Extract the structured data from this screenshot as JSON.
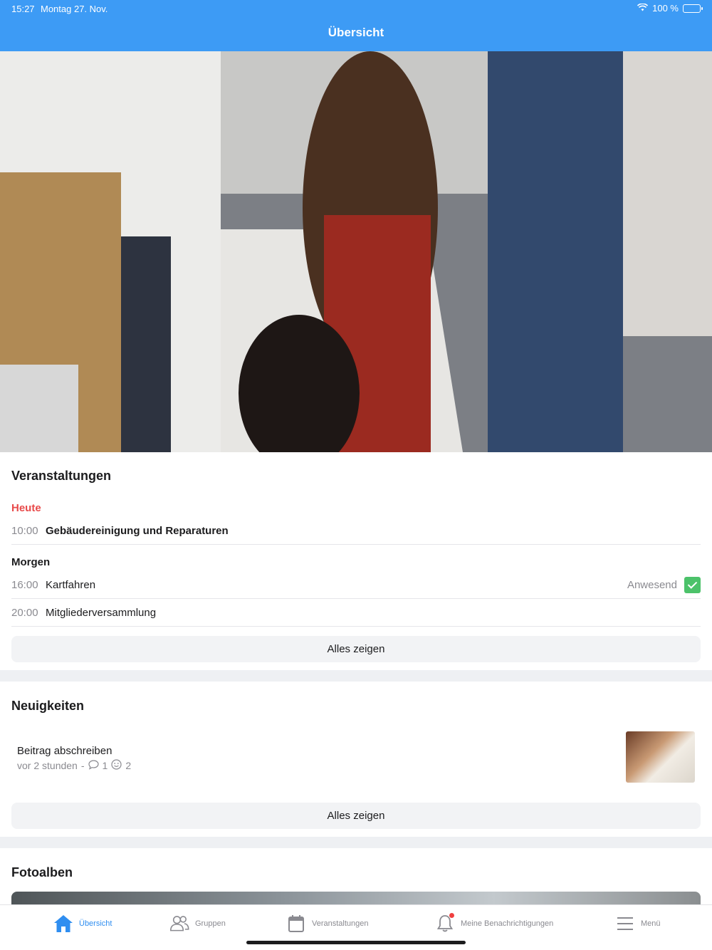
{
  "status_bar": {
    "time": "15:27",
    "date": "Montag 27. Nov.",
    "battery": "100 %"
  },
  "nav": {
    "title": "Übersicht"
  },
  "events": {
    "title": "Veranstaltungen",
    "today_label": "Heute",
    "today": [
      {
        "time": "10:00",
        "title": "Gebäudereinigung und Reparaturen"
      }
    ],
    "tomorrow_label": "Morgen",
    "tomorrow": [
      {
        "time": "16:00",
        "title": "Kartfahren",
        "status": "Anwesend"
      },
      {
        "time": "20:00",
        "title": "Mitgliederversammlung"
      }
    ],
    "show_all": "Alles zeigen"
  },
  "news": {
    "title": "Neuigkeiten",
    "post": {
      "title": "Beitrag abschreiben",
      "age": "vor 2 stunden",
      "separator": "-",
      "comments": "1",
      "reactions": "2"
    },
    "show_all": "Alles zeigen"
  },
  "albums": {
    "title": "Fotoalben"
  },
  "tabbar": {
    "items": [
      {
        "label": "Übersicht",
        "icon": "home-icon"
      },
      {
        "label": "Gruppen",
        "icon": "people-icon"
      },
      {
        "label": "Veranstaltungen",
        "icon": "calendar-icon"
      },
      {
        "label": "Meine Benachrichtigungen",
        "icon": "bell-icon"
      },
      {
        "label": "Menü",
        "icon": "menu-icon"
      }
    ]
  },
  "colors": {
    "accent": "#3d9bf5",
    "today": "#e84a4a",
    "attend": "#4cc26a"
  }
}
